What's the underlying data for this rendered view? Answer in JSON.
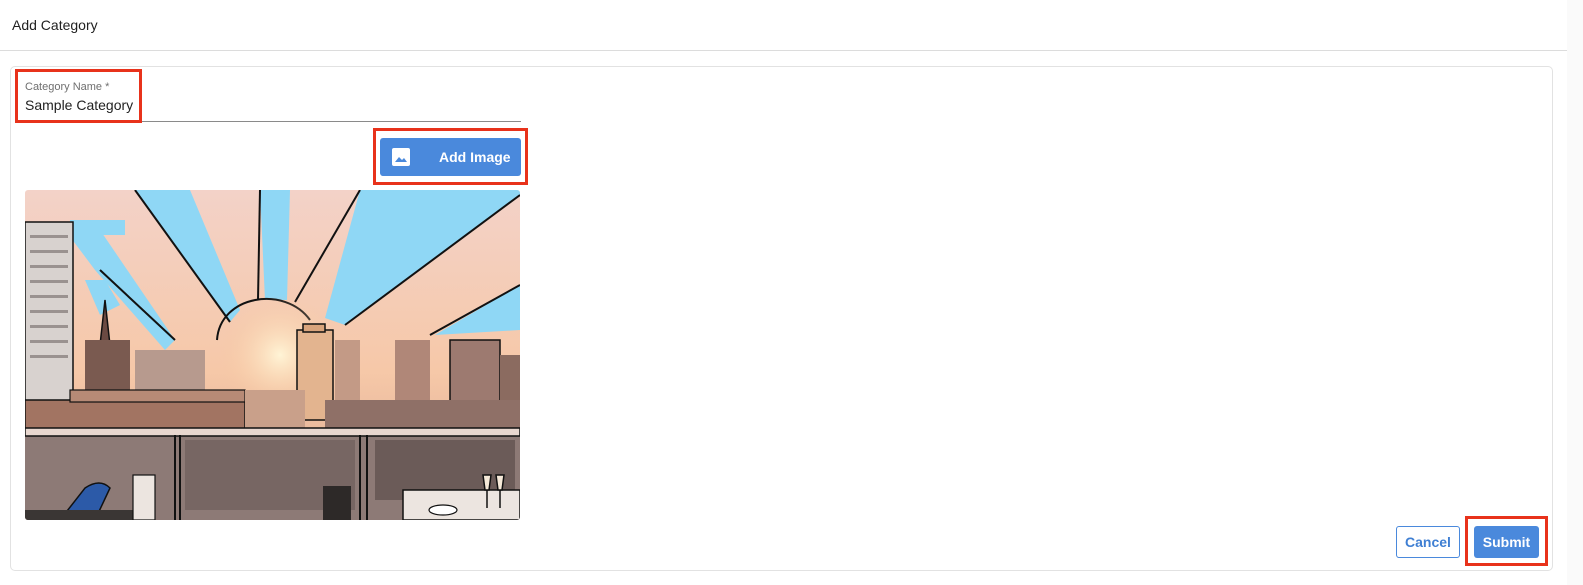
{
  "header": {
    "title": "Add Category"
  },
  "form": {
    "category_name": {
      "label": "Category Name *",
      "value": "Sample Category"
    },
    "add_image_label": "Add Image",
    "image_icon": "image-icon",
    "preview_image": "city-skyline-sunset-illustration"
  },
  "actions": {
    "cancel_label": "Cancel",
    "submit_label": "Submit"
  },
  "colors": {
    "primary": "#4a89dc",
    "highlight": "#e8321b",
    "sky": "#8fd7f5"
  }
}
